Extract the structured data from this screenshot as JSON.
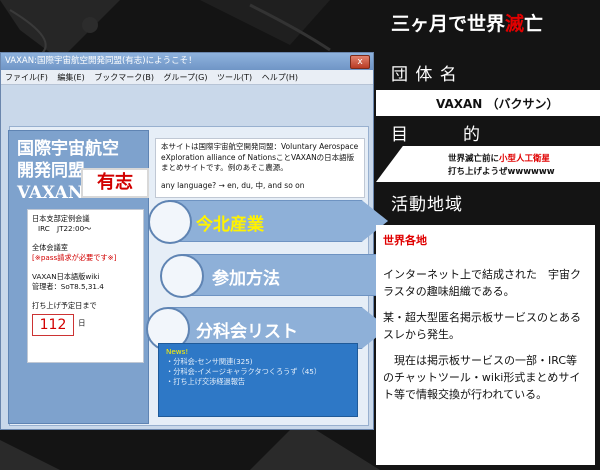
{
  "browser": {
    "title": "VAXAN:国際宇宙航空開発同盟(有志)にようこそ！",
    "close_label": "x",
    "menu": [
      "ファイル(F)",
      "編集(E)",
      "ブックマーク(B)",
      "グループ(G)",
      "ツール(T)",
      "ヘルプ(H)"
    ]
  },
  "site": {
    "title_line1": "国際宇宙航空",
    "title_line2": "開発同盟",
    "title_line3": "VAXAN",
    "yushi": "有志",
    "info": {
      "meeting": "日本支部定例会議",
      "meeting_time": "IRC　JT22:00～",
      "hall": "全体会議室",
      "hall_note": "[※pass請求が必要です※]",
      "wiki": "VAXAN日本語版wiki",
      "admin": "管理者：SoT8.5,31.4",
      "countdown_label": "打ち上げ予定日まで",
      "countdown_value": "112",
      "countdown_unit": "日"
    },
    "intro": {
      "text": "本サイトは国際宇宙航空開発同盟：Voluntary Aerospace eXploration alliance of NationsことVAXANの日本語版まとめサイトです。例のあそこ農源。",
      "lang": "any language? → en, du, 中, and so on"
    },
    "nav": [
      "今北産業",
      "参加方法",
      "分科会リスト"
    ],
    "news": {
      "heading": "News!",
      "items": [
        "・分科会-センサ関連(325)",
        "・分科会-イメージキャラクタつくろうず（45）",
        "・打ち上げ交渉経過報告"
      ]
    }
  },
  "slide": {
    "title_pre": "三ヶ月で世界",
    "title_red": "滅",
    "title_post": "亡",
    "name_label": "団 体 名",
    "name_value": "VAXAN （バクサン）",
    "purpose_label": "目　　　的",
    "purpose_line1_pre": "世界滅亡前に",
    "purpose_line1_red": "小型人工衛星",
    "purpose_line2": "打ち上げようぜwwwwww",
    "region_label": "活動地域",
    "region_heading": "世界各地",
    "region_p1": "インターネット上で結成された　宇宙クラスタの趣味組織である。",
    "region_p2": "某・超大型匿名掲示板サービスのとあるスレから発生。",
    "region_p3": "　現在は掲示板サービスの一部・IRC等のチャットツール・wiki形式まとめサイト等で情報交換が行われている。"
  },
  "colors": {
    "accent_red": "#e00000",
    "window_blue": "#7ea2cd",
    "news_blue": "#2e78c6"
  }
}
